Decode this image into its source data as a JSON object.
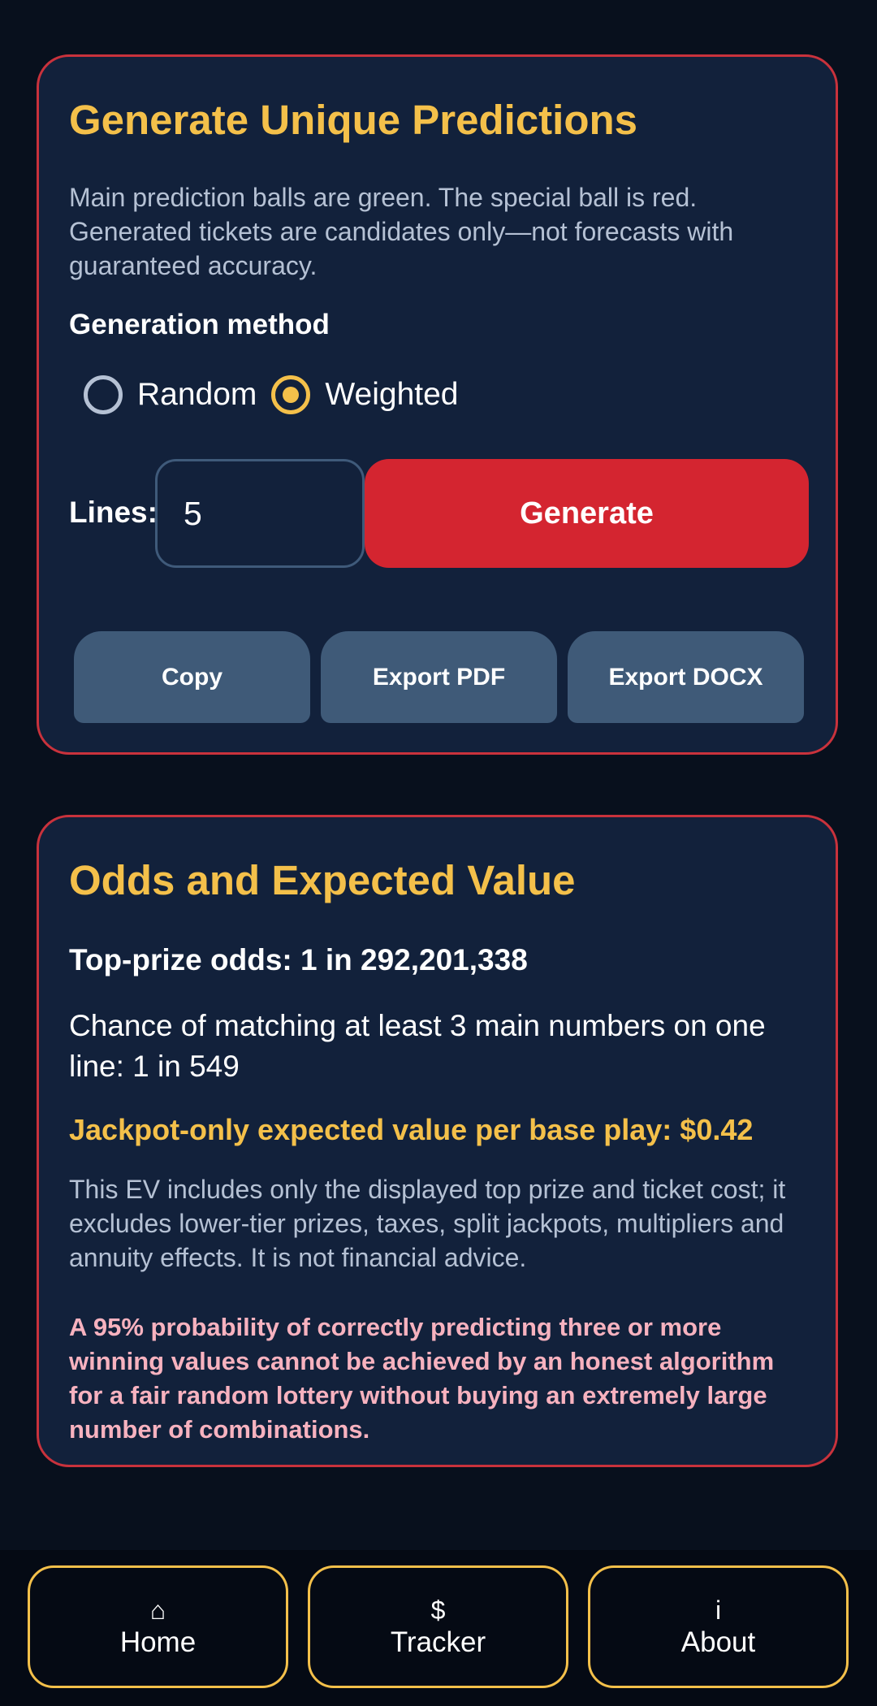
{
  "generator": {
    "title": "Generate Unique Predictions",
    "description": "Main prediction balls are green. The special ball is red. Generated tickets are candidates only—not forecasts with guaranteed accuracy.",
    "method_label": "Generation method",
    "methods": [
      {
        "label": "Random",
        "selected": false
      },
      {
        "label": "Weighted",
        "selected": true
      }
    ],
    "lines_label": "Lines:",
    "lines_value": "5",
    "generate_label": "Generate",
    "actions": [
      "Copy",
      "Export PDF",
      "Export DOCX"
    ]
  },
  "odds": {
    "title": "Odds and Expected Value",
    "top_prize": "Top-prize odds: 1 in 292,201,338",
    "match_three": "Chance of matching at least 3 main numbers on one line: 1 in 549",
    "expected_value": "Jackpot-only expected value per base play: $0.42",
    "disclaimer": "This EV includes only the displayed top prize and ticket cost; it excludes lower-tier prizes, taxes, split jackpots, multipliers and annuity effects. It is not financial advice.",
    "warning": "A 95% probability of correctly predicting three or more winning values cannot be achieved by an honest algorithm for a fair random lottery without buying an extremely large number of combinations."
  },
  "nav": [
    {
      "icon": "⌂",
      "icon_name": "home-icon",
      "label": "Home"
    },
    {
      "icon": "$",
      "icon_name": "dollar-icon",
      "label": "Tracker"
    },
    {
      "icon": "i",
      "icon_name": "info-icon",
      "label": "About"
    }
  ],
  "colors": {
    "background": "#08101d",
    "card": "#12213b",
    "card_border": "#c9323c",
    "accent_gold": "#f4c04a",
    "generate_red": "#d42530",
    "warning_pink": "#f7b2bf"
  }
}
